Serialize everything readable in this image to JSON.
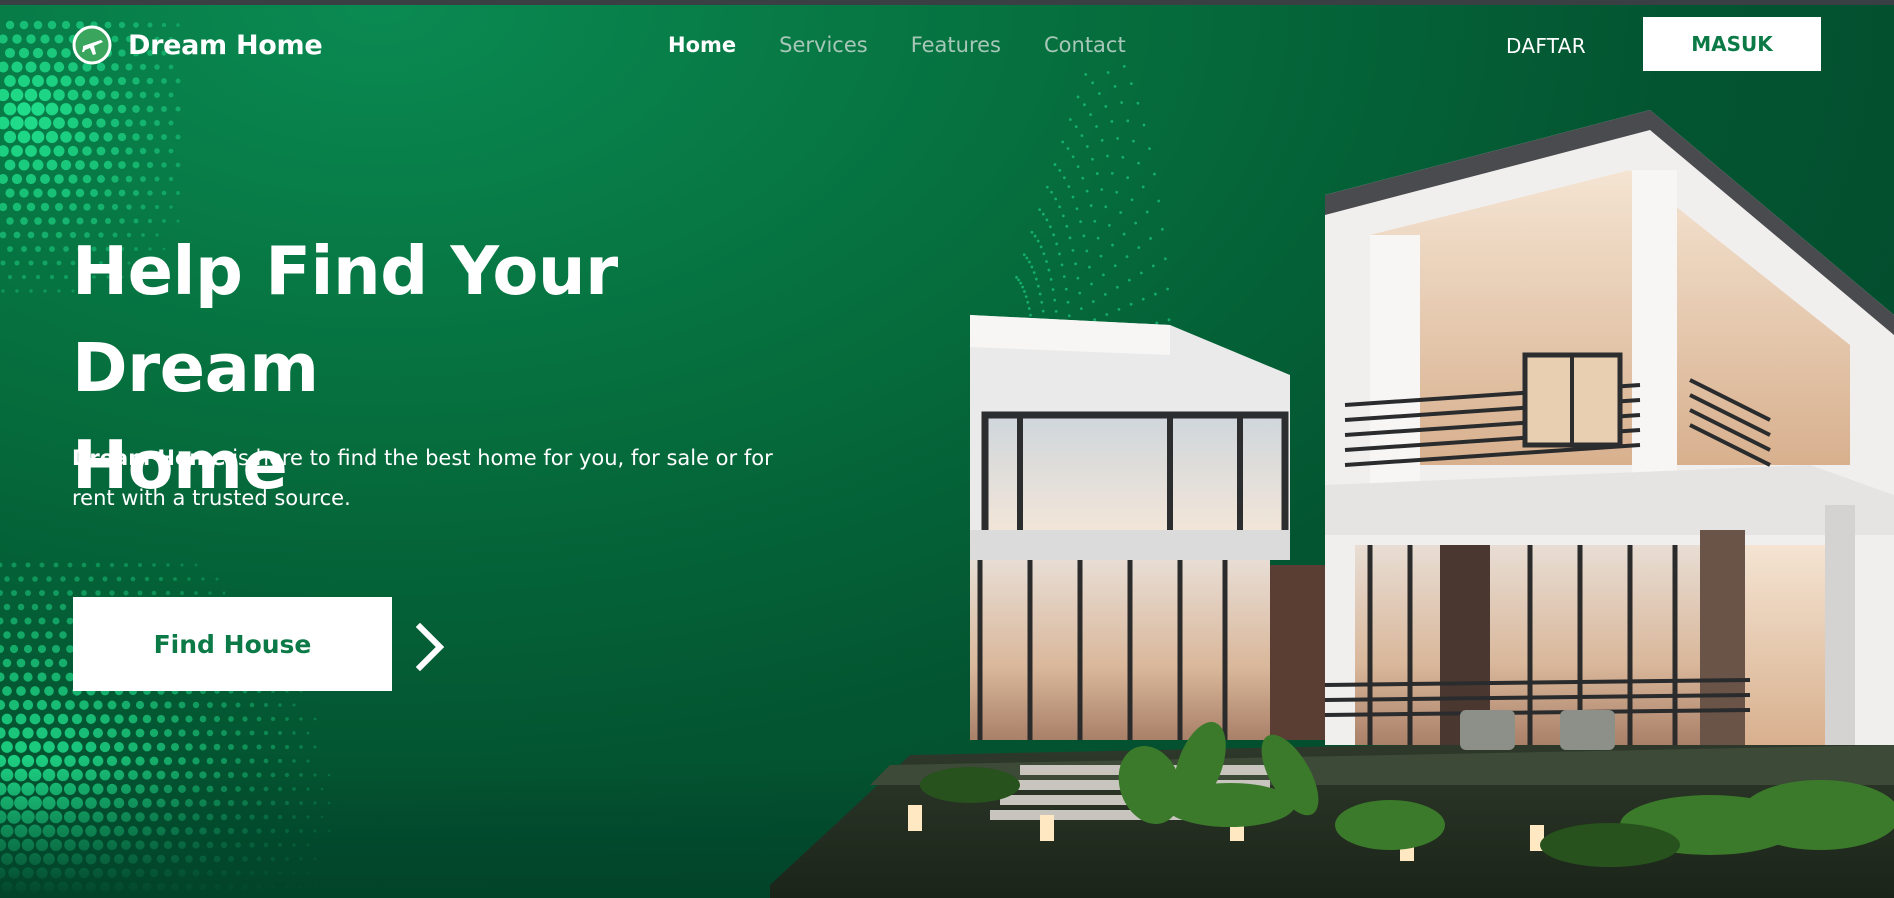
{
  "brand": {
    "name": "Dream Home",
    "logo_icon": "airplane-globe-icon"
  },
  "nav": {
    "items": [
      {
        "label": "Home",
        "active": true
      },
      {
        "label": "Services",
        "active": false
      },
      {
        "label": "Features",
        "active": false
      },
      {
        "label": "Contact",
        "active": false
      }
    ],
    "register_label": "DAFTAR",
    "login_label": "MASUK"
  },
  "hero": {
    "headline_line1": "Help Find Your Dream",
    "headline_line2": "Home",
    "desc_bold": "Dream Home",
    "desc_rest": " is here to find the best home for you, for sale or for rent with a trusted source.",
    "cta_label": "Find House",
    "next_icon": "chevron-right-icon",
    "image": "modern-house-illustration"
  },
  "colors": {
    "primary_green": "#0b7a46",
    "dark_green": "#02432a",
    "accent_dots": "#1fe08a",
    "white": "#ffffff"
  }
}
